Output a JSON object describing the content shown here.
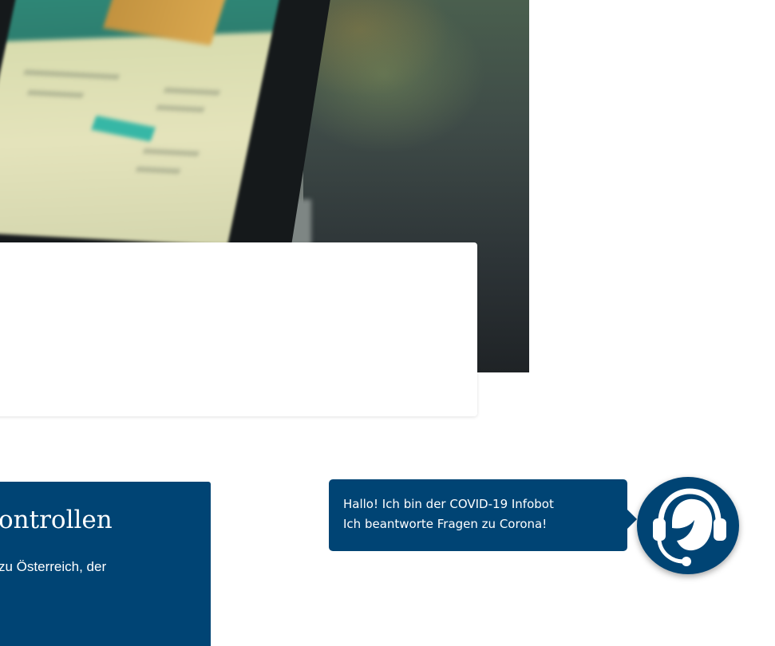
{
  "teaser": {
    "title": "ontrollen",
    "text": "zu Österreich, der"
  },
  "chatbot": {
    "greeting_line1": "Hallo! Ich bin der COVID-19 Infobot",
    "greeting_line2": "Ich beantworte Fragen zu Corona!",
    "avatar_icon": "headset-agent-icon"
  },
  "colors": {
    "brand_blue": "#004474",
    "white": "#ffffff",
    "accent_teal": "#36b7a6"
  }
}
